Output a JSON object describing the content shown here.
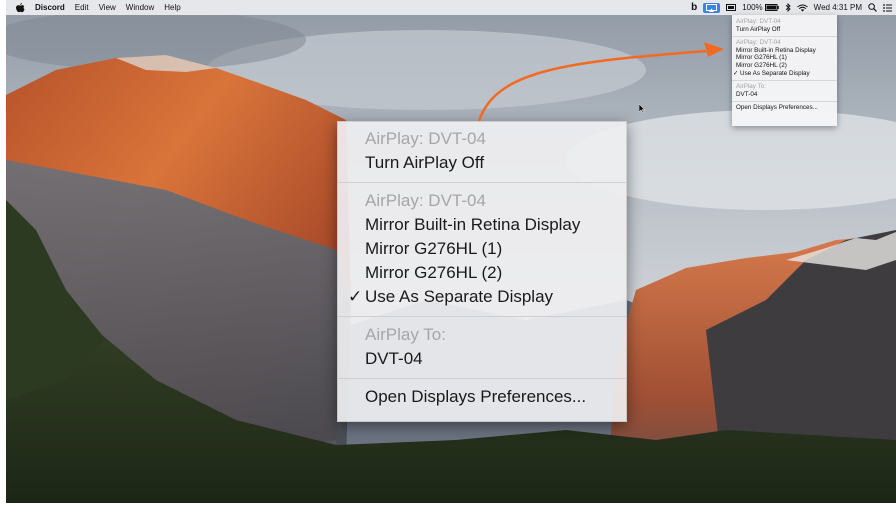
{
  "menubar": {
    "app_name": "Discord",
    "menus": [
      "Edit",
      "View",
      "Window",
      "Help"
    ],
    "battery_percent": "100%",
    "clock": "Wed 4:31 PM",
    "status_icons": [
      "discord-b-icon",
      "airplay-icon",
      "display-icon",
      "battery-icon",
      "bluetooth-icon",
      "wifi-icon",
      "search-icon",
      "list-icon"
    ]
  },
  "airplay_menu": {
    "header1": "AirPlay: DVT-04",
    "turn_off": "Turn AirPlay Off",
    "header2": "AirPlay: DVT-04",
    "mirror_builtin": "Mirror Built-in Retina Display",
    "mirror_1": "Mirror G276HL (1)",
    "mirror_2": "Mirror G276HL (2)",
    "separate": "Use As Separate Display",
    "check_mark": "✓",
    "header3": "AirPlay To:",
    "device": "DVT-04",
    "prefs": "Open Displays Preferences..."
  },
  "colors": {
    "arrow": "#f26a21",
    "selection": "#3d82e6",
    "menu_bg": "#eeeef0",
    "header_text": "#a6a6a9"
  }
}
